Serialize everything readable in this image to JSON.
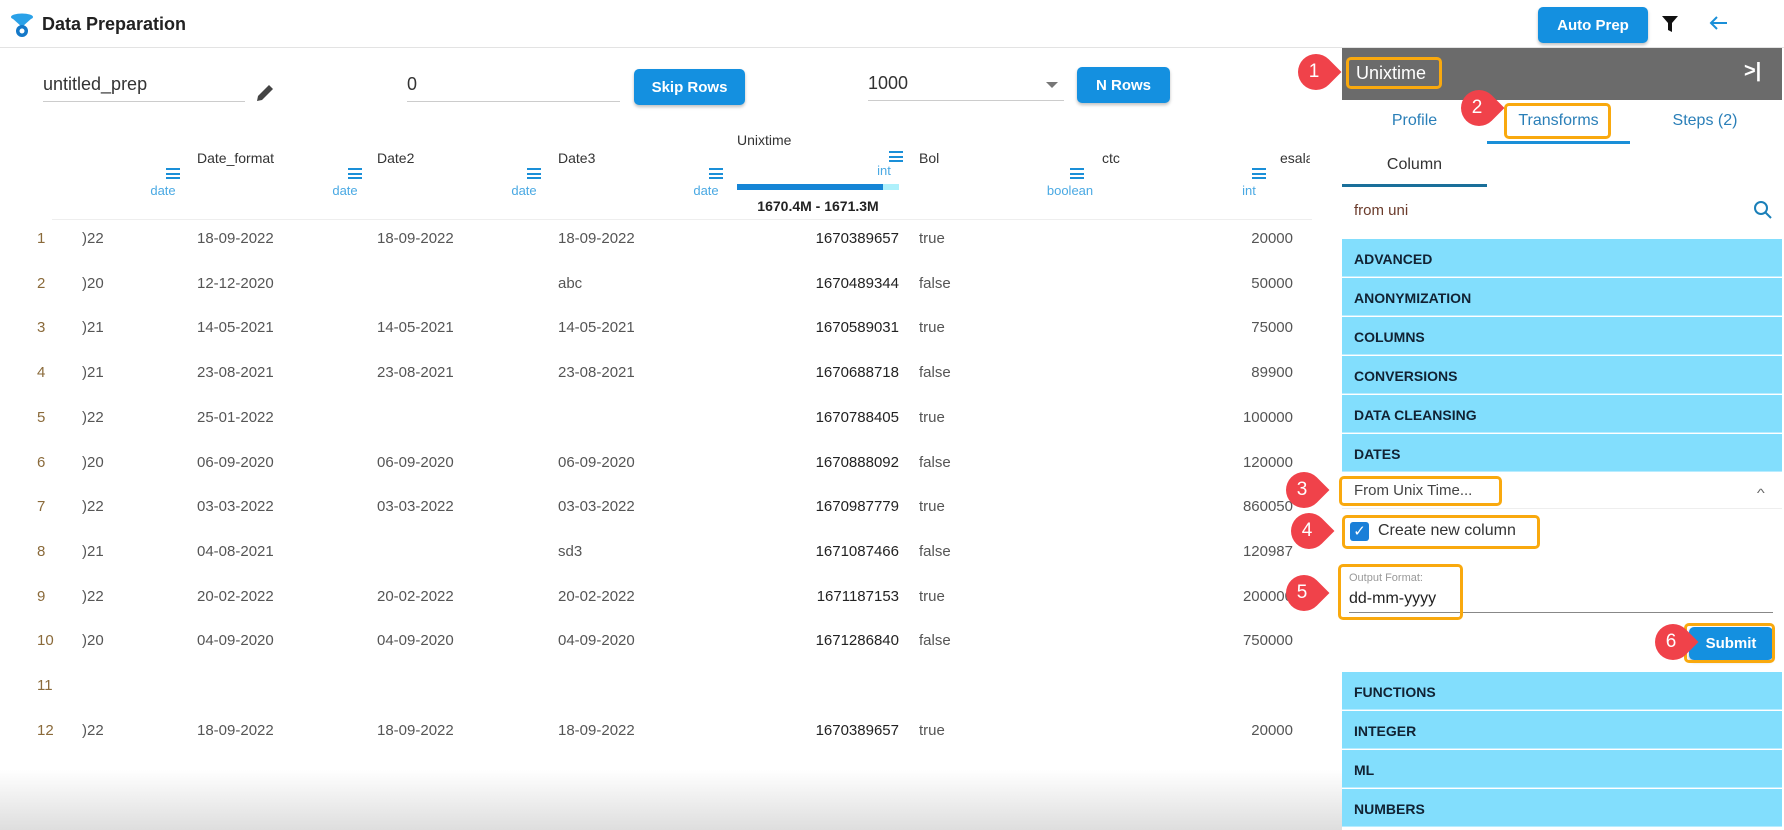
{
  "header": {
    "title": "Data Preparation",
    "auto_prep": "Auto Prep",
    "icons": [
      "logo-icon",
      "filter-icon",
      "back-arrow-icon"
    ]
  },
  "toolbar": {
    "prep_name": "untitled_prep",
    "skip_value": "0",
    "skip_label": "Skip Rows",
    "nrows_value": "1000",
    "nrows_label": "N Rows"
  },
  "table": {
    "columns": [
      {
        "name": "",
        "type": "date"
      },
      {
        "name": "Date_format",
        "type": "date"
      },
      {
        "name": "Date2",
        "type": "date"
      },
      {
        "name": "Date3",
        "type": "date"
      },
      {
        "name": "Unixtime",
        "type": "int",
        "range": "1670.4M - 1671.3M",
        "fill": 0.9
      },
      {
        "name": "Bol",
        "type": "boolean"
      },
      {
        "name": "ctc",
        "type": "int"
      },
      {
        "name": "esala",
        "type": ""
      }
    ],
    "rows": [
      [
        "1",
        ")22",
        "18-09-2022",
        "18-09-2022",
        "18-09-2022",
        "1670389657",
        "true",
        "20000"
      ],
      [
        "2",
        ")20",
        "12-12-2020",
        "",
        "abc",
        "1670489344",
        "false",
        "50000"
      ],
      [
        "3",
        ")21",
        "14-05-2021",
        "14-05-2021",
        "14-05-2021",
        "1670589031",
        "true",
        "75000"
      ],
      [
        "4",
        ")21",
        "23-08-2021",
        "23-08-2021",
        "23-08-2021",
        "1670688718",
        "false",
        "89900"
      ],
      [
        "5",
        ")22",
        "25-01-2022",
        "",
        "",
        "1670788405",
        "true",
        "100000"
      ],
      [
        "6",
        ")20",
        "06-09-2020",
        "06-09-2020",
        "06-09-2020",
        "1670888092",
        "false",
        "120000"
      ],
      [
        "7",
        ")22",
        "03-03-2022",
        "03-03-2022",
        "03-03-2022",
        "1670987779",
        "true",
        "860050"
      ],
      [
        "8",
        ")21",
        "04-08-2021",
        "",
        "sd3",
        "1671087466",
        "false",
        "120987"
      ],
      [
        "9",
        ")22",
        "20-02-2022",
        "20-02-2022",
        "20-02-2022",
        "1671187153",
        "true",
        "200000"
      ],
      [
        "10",
        ")20",
        "04-09-2020",
        "04-09-2020",
        "04-09-2020",
        "1671286840",
        "false",
        "750000"
      ],
      [
        "11",
        "",
        "",
        "",
        "",
        "",
        "",
        ""
      ],
      [
        "12",
        ")22",
        "18-09-2022",
        "18-09-2022",
        "18-09-2022",
        "1670389657",
        "true",
        "20000"
      ]
    ]
  },
  "panel": {
    "column_title": "Unixtime",
    "tabs": [
      "Profile",
      "Transforms",
      "Steps (2)"
    ],
    "subtab": "Column",
    "search_value": "from uni",
    "categories_top": [
      "ADVANCED",
      "ANONYMIZATION",
      "COLUMNS",
      "CONVERSIONS",
      "DATA CLEANSING",
      "DATES"
    ],
    "transform": "From Unix Time...",
    "create_new_column": "Create new column",
    "create_new_checked": true,
    "output_format_label": "Output Format:",
    "output_format_value": "dd-mm-yyyy",
    "submit": "Submit",
    "categories_bottom": [
      "FUNCTIONS",
      "INTEGER",
      "ML",
      "NUMBERS"
    ]
  },
  "annotations": [
    "1",
    "2",
    "3",
    "4",
    "5",
    "6"
  ],
  "colors": {
    "accent": "#1490e0",
    "category": "#82defd",
    "marker": "#f0424a",
    "highlight": "#f9a90e",
    "panel_header": "#6b6b6b"
  }
}
